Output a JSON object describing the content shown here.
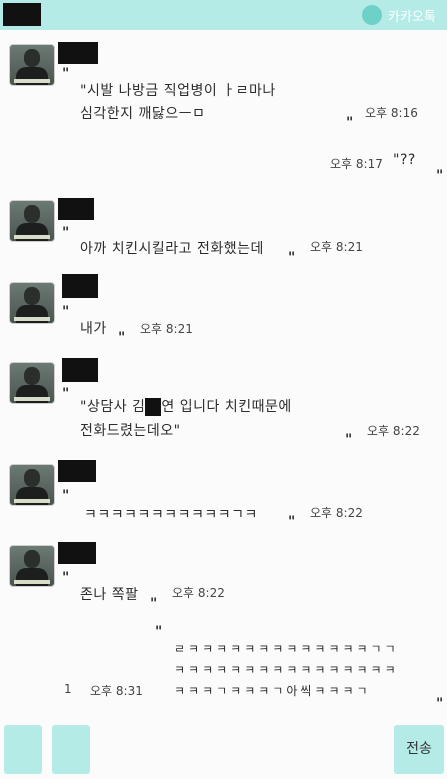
{
  "app": {
    "name": "카카오톡",
    "brand_color": "#b4ebe6"
  },
  "messages": [
    {
      "lines": [
        "\"시발 나방금 직업병이 ㅏㄹ마나",
        "심각한지 깨닳으ㅡㅁ"
      ],
      "time": "오후 8:16",
      "side": "left"
    },
    {
      "lines": [
        "\"??"
      ],
      "time": "오후 8:17",
      "side": "right"
    },
    {
      "lines": [
        "아까 치킨시킬라고 전화했는데"
      ],
      "time": "오후 8:21",
      "side": "left"
    },
    {
      "lines": [
        "내가"
      ],
      "time": "오후 8:21",
      "side": "left"
    },
    {
      "lines": [
        "\"상담사 김",
        "연 입니다 치킨때문에",
        "전화드렸는데오\""
      ],
      "time": "오후 8:22",
      "side": "left"
    },
    {
      "lines": [
        "ㅋㅋㅋㅋㅋㅋㅋㅋㅋㅋㅋㄱㅋ"
      ],
      "time": "오후 8:22",
      "side": "left"
    },
    {
      "lines": [
        "존나 쪽팔"
      ],
      "time": "오후 8:22",
      "side": "left"
    },
    {
      "lines": [
        "ㄹㅋㅋㅋㅋㅋㅋㅋㅋㅋㅋㅋㅋㅋㄱㄱ",
        "ㅋㅋㅋㅋㅋㅋㅋㅋㅋㅋㅋㅋㅋㅋㅋㅋ",
        "ㅋㅋㅋㄱㅋㅋㅋㄱ아씩ㅋㅋㅋㄱ"
      ],
      "time": "오후 8:31",
      "unread": "1",
      "side": "right"
    }
  ],
  "input": {
    "send_label": "전송"
  }
}
